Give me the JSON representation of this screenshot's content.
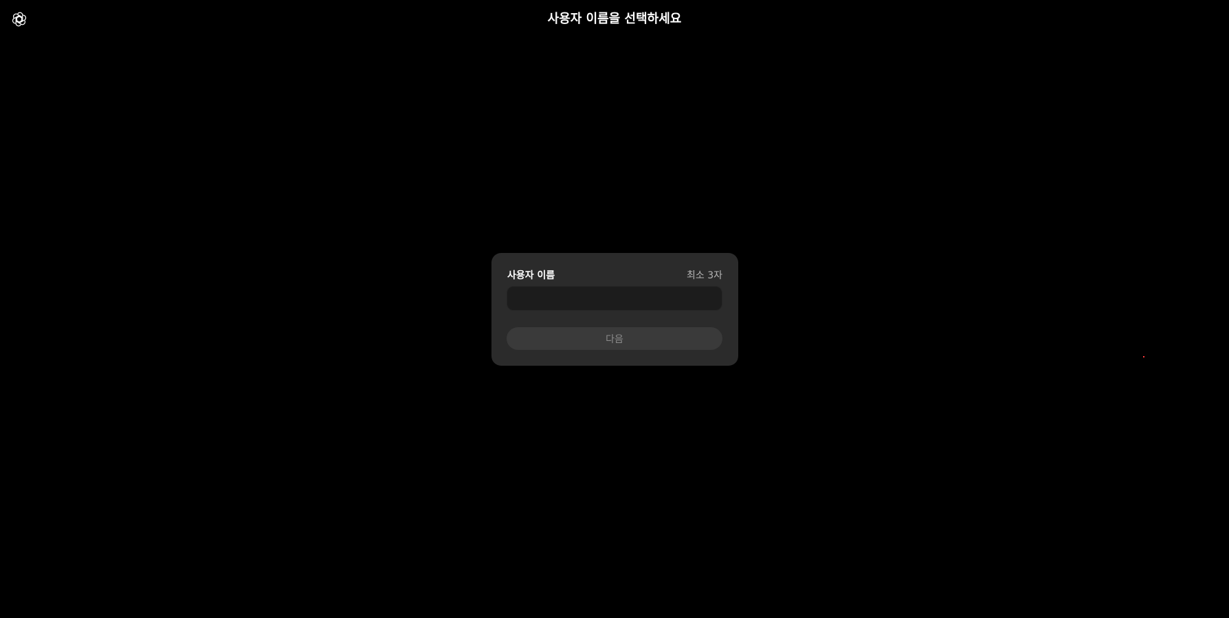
{
  "header": {
    "logo_icon": "openai-logo-icon",
    "title": "사용자 이름을 선택하세요"
  },
  "form": {
    "username_label": "사용자 이름",
    "username_hint": "최소 3자",
    "username_value": "",
    "username_placeholder": "",
    "next_label": "다음"
  },
  "colors": {
    "background": "#000000",
    "card": "#2b2b2b",
    "input": "#1c1c1c",
    "button": "#3a3a3a",
    "button_text": "#8c8c8c"
  }
}
